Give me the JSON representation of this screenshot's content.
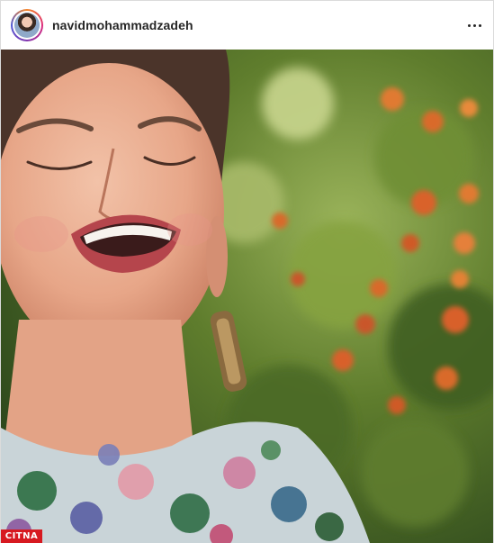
{
  "post": {
    "username": "navidmohammadzadeh",
    "more_icon": "more-horizontal-icon",
    "photo_alt": "Woman laughing with eyes closed in front of green foliage with orange flowers"
  },
  "watermark": {
    "text": "CITNA"
  },
  "colors": {
    "header_text": "#262626",
    "border": "#dbdbdb",
    "watermark_bg": "#d71920"
  }
}
